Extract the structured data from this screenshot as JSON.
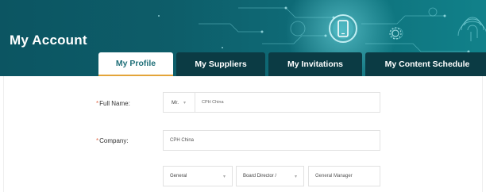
{
  "page": {
    "title": "My Account"
  },
  "tabs": [
    {
      "label": "My Profile",
      "active": true
    },
    {
      "label": "My Suppliers",
      "active": false
    },
    {
      "label": "My Invitations",
      "active": false
    },
    {
      "label": "My Content Schedule",
      "active": false
    }
  ],
  "form": {
    "required_marker": "*",
    "full_name": {
      "label": "Full Name:",
      "salutation": "Mr.",
      "value": "CPH China"
    },
    "company": {
      "label": "Company:",
      "value": "CPH China"
    },
    "position": {
      "department": "General",
      "role": "Board Director /",
      "job_title": "General Manager"
    }
  },
  "icons": {
    "dropdown": "chevron-down-icon",
    "header_device": "mobile-device-icon",
    "header_gear": "gear-icon",
    "header_fingerprint": "fingerprint-icon"
  },
  "colors": {
    "header": "#0d5d69",
    "tab_inactive": "#0b3b44",
    "tab_active_text": "#1f6f78",
    "tab_active_underline": "#e3a43a",
    "required": "#e06a4a"
  }
}
